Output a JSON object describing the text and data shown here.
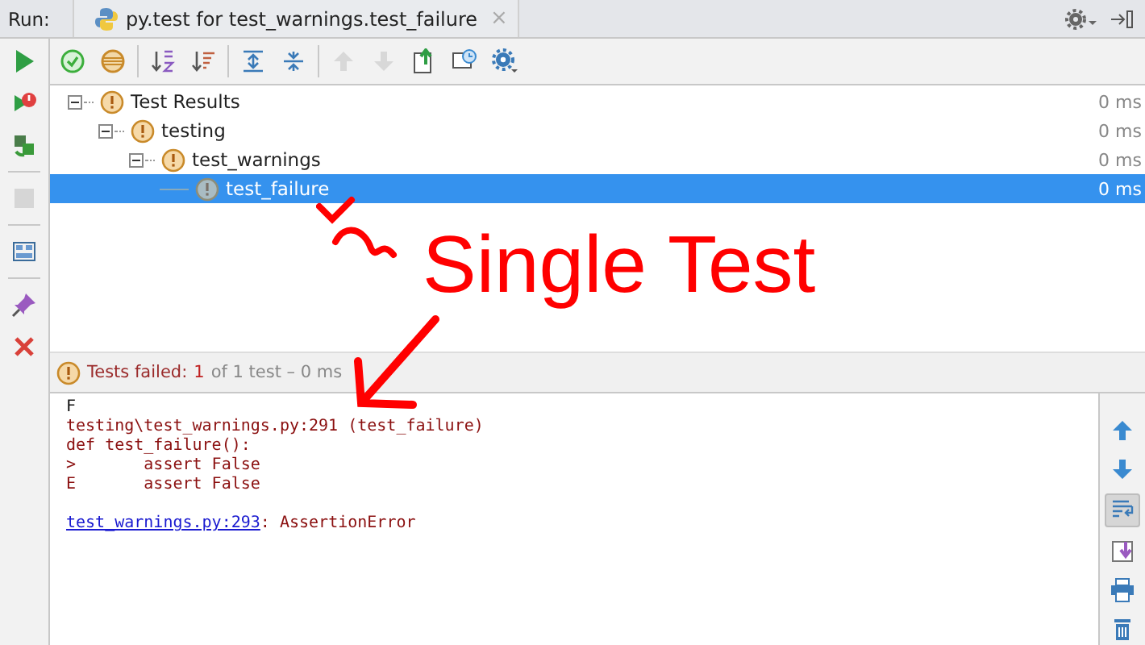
{
  "run_label": "Run:",
  "tab": {
    "title": "py.test for test_warnings.test_failure",
    "close": "×"
  },
  "left_tools": [
    {
      "kind": "run",
      "disabled": false
    },
    {
      "kind": "rerun-failed",
      "disabled": false
    },
    {
      "kind": "toggle-auto",
      "disabled": false
    },
    {
      "kind": "stop",
      "disabled": true
    },
    {
      "kind": "layout",
      "disabled": false
    },
    {
      "kind": "pin",
      "disabled": false
    },
    {
      "kind": "close",
      "disabled": false
    }
  ],
  "top_tools": [
    {
      "kind": "passed",
      "disabled": false
    },
    {
      "kind": "ignored",
      "disabled": false
    },
    {
      "kind": "sort-alpha",
      "disabled": false
    },
    {
      "kind": "sort-duration",
      "disabled": false
    },
    {
      "kind": "expand",
      "disabled": false
    },
    {
      "kind": "collapse",
      "disabled": false
    },
    {
      "kind": "prev",
      "disabled": true
    },
    {
      "kind": "next",
      "disabled": true
    },
    {
      "kind": "export",
      "disabled": false
    },
    {
      "kind": "history",
      "disabled": false
    },
    {
      "kind": "settings",
      "disabled": false
    }
  ],
  "tree": [
    {
      "label": "Test Results",
      "kind": "warning",
      "duration": "0 ms",
      "expanded": true,
      "selected": false,
      "children": [
        {
          "label": "testing",
          "kind": "warning",
          "duration": "0 ms",
          "expanded": true,
          "selected": false,
          "children": [
            {
              "label": "test_warnings",
              "kind": "warning",
              "duration": "0 ms",
              "expanded": true,
              "selected": false,
              "children": [
                {
                  "label": "test_failure",
                  "kind": "warning",
                  "duration": "0 ms",
                  "selected": true
                }
              ]
            }
          ]
        }
      ]
    }
  ],
  "status": {
    "label": "Tests failed:",
    "count": "1",
    "summary": "of 1 test – 0 ms"
  },
  "console": [
    {
      "kind": "stdout",
      "text": "F"
    },
    {
      "kind": "stderr",
      "text": "testing\\test_warnings.py:291 (test_failure)"
    },
    {
      "kind": "stderr",
      "text": "def test_failure():"
    },
    {
      "kind": "stderr",
      "text": ">       assert False"
    },
    {
      "kind": "stderr",
      "text": "E       assert False"
    },
    {
      "kind": "blank"
    },
    {
      "kind": "link",
      "link": "test_warnings.py:293",
      "text": ": AssertionError"
    }
  ],
  "console_tools": [
    {
      "kind": "up",
      "on": false
    },
    {
      "kind": "down",
      "on": false
    },
    {
      "kind": "soft-wrap",
      "on": true
    },
    {
      "kind": "scroll-end",
      "on": false
    },
    {
      "kind": "print",
      "on": false
    },
    {
      "kind": "clear",
      "on": false
    }
  ],
  "annotation": {
    "text": "Single Test"
  }
}
